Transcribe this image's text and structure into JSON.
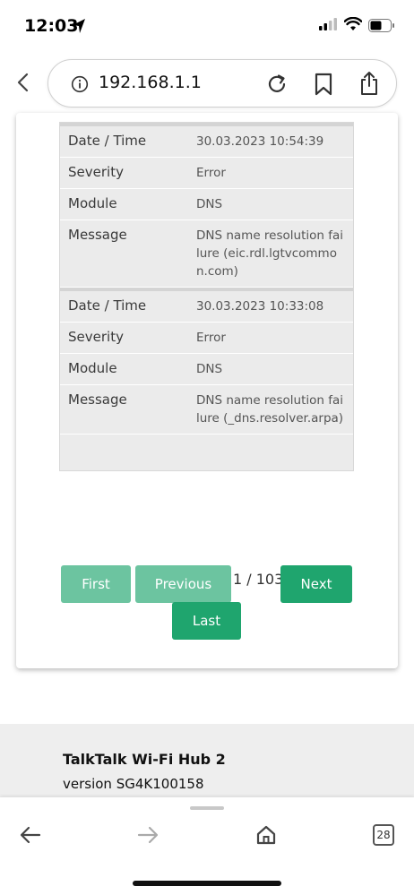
{
  "status_bar": {
    "time": "12:03"
  },
  "browser": {
    "url": "192.168.1.1"
  },
  "log_entries": [
    {
      "rows": [
        {
          "key": "Date / Time",
          "value": "30.03.2023 10:54:39"
        },
        {
          "key": "Severity",
          "value": "Error"
        },
        {
          "key": "Module",
          "value": "DNS"
        },
        {
          "key": "Message",
          "value": "DNS name resolution failure (eic.rdl.lgtvcommon.com)"
        }
      ]
    },
    {
      "rows": [
        {
          "key": "Date / Time",
          "value": "30.03.2023 10:33:08"
        },
        {
          "key": "Severity",
          "value": "Error"
        },
        {
          "key": "Module",
          "value": "DNS"
        },
        {
          "key": "Message",
          "value": "DNS name resolution failure (_dns.resolver.arpa)"
        }
      ]
    }
  ],
  "pagination": {
    "first_label": "First",
    "previous_label": "Previous",
    "page_indicator": "1 / 103",
    "next_label": "Next",
    "last_label": "Last"
  },
  "footer": {
    "product": "TalkTalk Wi-Fi Hub 2",
    "version": "version SG4K100158"
  },
  "toolbar": {
    "tabs_count": "28"
  },
  "colors": {
    "accent": "#1fa56e",
    "accent_disabled": "#6cc4a0"
  }
}
